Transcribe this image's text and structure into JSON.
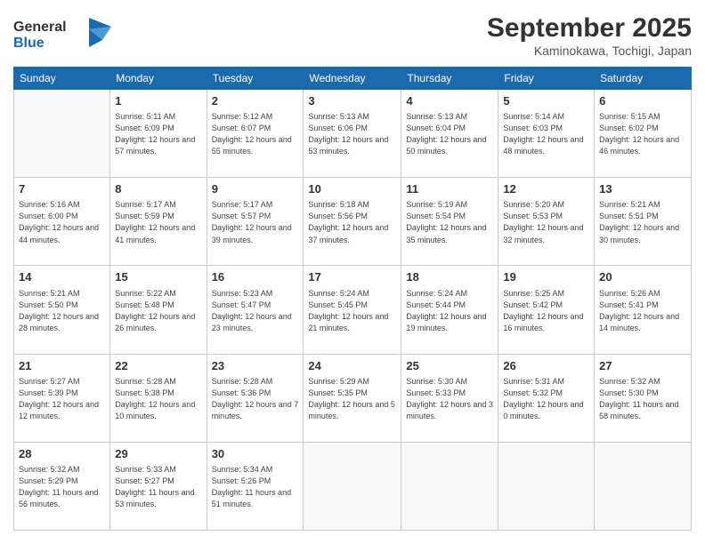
{
  "header": {
    "logo_line1": "General",
    "logo_line2": "Blue",
    "month": "September 2025",
    "location": "Kaminokawa, Tochigi, Japan"
  },
  "days_of_week": [
    "Sunday",
    "Monday",
    "Tuesday",
    "Wednesday",
    "Thursday",
    "Friday",
    "Saturday"
  ],
  "weeks": [
    [
      {
        "day": "",
        "info": ""
      },
      {
        "day": "1",
        "info": "Sunrise: 5:11 AM\nSunset: 6:09 PM\nDaylight: 12 hours\nand 57 minutes."
      },
      {
        "day": "2",
        "info": "Sunrise: 5:12 AM\nSunset: 6:07 PM\nDaylight: 12 hours\nand 55 minutes."
      },
      {
        "day": "3",
        "info": "Sunrise: 5:13 AM\nSunset: 6:06 PM\nDaylight: 12 hours\nand 53 minutes."
      },
      {
        "day": "4",
        "info": "Sunrise: 5:13 AM\nSunset: 6:04 PM\nDaylight: 12 hours\nand 50 minutes."
      },
      {
        "day": "5",
        "info": "Sunrise: 5:14 AM\nSunset: 6:03 PM\nDaylight: 12 hours\nand 48 minutes."
      },
      {
        "day": "6",
        "info": "Sunrise: 5:15 AM\nSunset: 6:02 PM\nDaylight: 12 hours\nand 46 minutes."
      }
    ],
    [
      {
        "day": "7",
        "info": "Sunrise: 5:16 AM\nSunset: 6:00 PM\nDaylight: 12 hours\nand 44 minutes."
      },
      {
        "day": "8",
        "info": "Sunrise: 5:17 AM\nSunset: 5:59 PM\nDaylight: 12 hours\nand 41 minutes."
      },
      {
        "day": "9",
        "info": "Sunrise: 5:17 AM\nSunset: 5:57 PM\nDaylight: 12 hours\nand 39 minutes."
      },
      {
        "day": "10",
        "info": "Sunrise: 5:18 AM\nSunset: 5:56 PM\nDaylight: 12 hours\nand 37 minutes."
      },
      {
        "day": "11",
        "info": "Sunrise: 5:19 AM\nSunset: 5:54 PM\nDaylight: 12 hours\nand 35 minutes."
      },
      {
        "day": "12",
        "info": "Sunrise: 5:20 AM\nSunset: 5:53 PM\nDaylight: 12 hours\nand 32 minutes."
      },
      {
        "day": "13",
        "info": "Sunrise: 5:21 AM\nSunset: 5:51 PM\nDaylight: 12 hours\nand 30 minutes."
      }
    ],
    [
      {
        "day": "14",
        "info": "Sunrise: 5:21 AM\nSunset: 5:50 PM\nDaylight: 12 hours\nand 28 minutes."
      },
      {
        "day": "15",
        "info": "Sunrise: 5:22 AM\nSunset: 5:48 PM\nDaylight: 12 hours\nand 26 minutes."
      },
      {
        "day": "16",
        "info": "Sunrise: 5:23 AM\nSunset: 5:47 PM\nDaylight: 12 hours\nand 23 minutes."
      },
      {
        "day": "17",
        "info": "Sunrise: 5:24 AM\nSunset: 5:45 PM\nDaylight: 12 hours\nand 21 minutes."
      },
      {
        "day": "18",
        "info": "Sunrise: 5:24 AM\nSunset: 5:44 PM\nDaylight: 12 hours\nand 19 minutes."
      },
      {
        "day": "19",
        "info": "Sunrise: 5:25 AM\nSunset: 5:42 PM\nDaylight: 12 hours\nand 16 minutes."
      },
      {
        "day": "20",
        "info": "Sunrise: 5:26 AM\nSunset: 5:41 PM\nDaylight: 12 hours\nand 14 minutes."
      }
    ],
    [
      {
        "day": "21",
        "info": "Sunrise: 5:27 AM\nSunset: 5:39 PM\nDaylight: 12 hours\nand 12 minutes."
      },
      {
        "day": "22",
        "info": "Sunrise: 5:28 AM\nSunset: 5:38 PM\nDaylight: 12 hours\nand 10 minutes."
      },
      {
        "day": "23",
        "info": "Sunrise: 5:28 AM\nSunset: 5:36 PM\nDaylight: 12 hours\nand 7 minutes."
      },
      {
        "day": "24",
        "info": "Sunrise: 5:29 AM\nSunset: 5:35 PM\nDaylight: 12 hours\nand 5 minutes."
      },
      {
        "day": "25",
        "info": "Sunrise: 5:30 AM\nSunset: 5:33 PM\nDaylight: 12 hours\nand 3 minutes."
      },
      {
        "day": "26",
        "info": "Sunrise: 5:31 AM\nSunset: 5:32 PM\nDaylight: 12 hours\nand 0 minutes."
      },
      {
        "day": "27",
        "info": "Sunrise: 5:32 AM\nSunset: 5:30 PM\nDaylight: 11 hours\nand 58 minutes."
      }
    ],
    [
      {
        "day": "28",
        "info": "Sunrise: 5:32 AM\nSunset: 5:29 PM\nDaylight: 11 hours\nand 56 minutes."
      },
      {
        "day": "29",
        "info": "Sunrise: 5:33 AM\nSunset: 5:27 PM\nDaylight: 11 hours\nand 53 minutes."
      },
      {
        "day": "30",
        "info": "Sunrise: 5:34 AM\nSunset: 5:26 PM\nDaylight: 11 hours\nand 51 minutes."
      },
      {
        "day": "",
        "info": ""
      },
      {
        "day": "",
        "info": ""
      },
      {
        "day": "",
        "info": ""
      },
      {
        "day": "",
        "info": ""
      }
    ]
  ]
}
